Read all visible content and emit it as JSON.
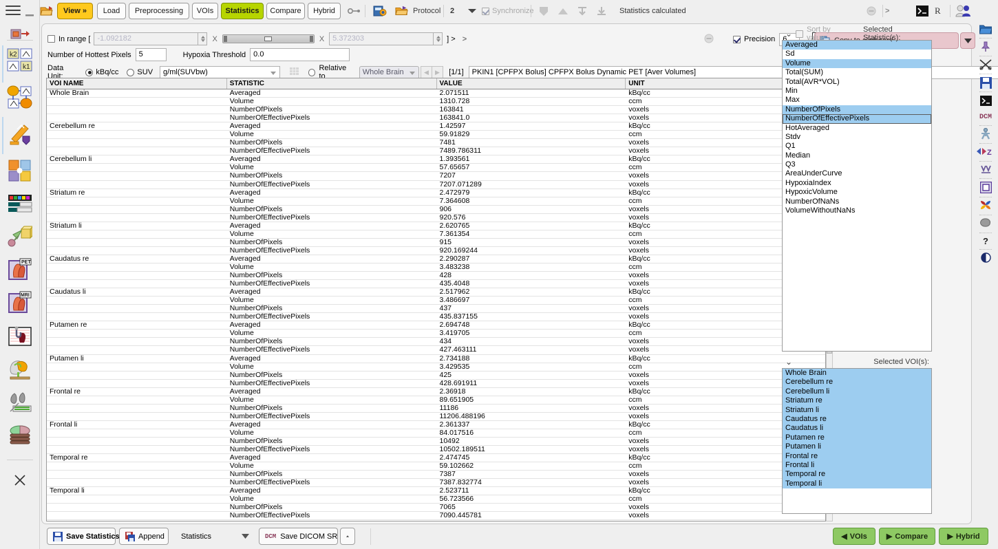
{
  "app": {
    "status_text": "Statistics calculated"
  },
  "toolbar": {
    "menu_icon": "hamburger-icon",
    "buttons": [
      {
        "label": "View »",
        "style": "yellow"
      },
      {
        "label": "Load",
        "style": "plain"
      },
      {
        "label": "Preprocessing",
        "style": "plain"
      },
      {
        "label": "VOIs",
        "style": "plain"
      },
      {
        "label": "Statistics",
        "style": "green"
      },
      {
        "label": "Compare",
        "style": "plain"
      },
      {
        "label": "Hybrid",
        "style": "plain"
      }
    ],
    "protocol_label": "Protocol",
    "series_number": "2",
    "synchronize_label": "Synchronize",
    "r_label": "R"
  },
  "controls": {
    "in_range_label": "In range [",
    "in_range_checked": false,
    "range_min": "-1.092182",
    "range_max": "5.372303",
    "range_close": "] >",
    "multiply_symbol": "X",
    "hottest_pixels_label": "Number of Hottest Pixels",
    "hottest_pixels_value": "5",
    "hypoxia_label": "Hypoxia Threshold",
    "hypoxia_value": "0.0",
    "data_unit_label": "Data Unit:",
    "unit_kbq_label": "kBq/cc",
    "unit_suv_label": "SUV",
    "suv_combo_value": "g/ml(SUVbw)",
    "relative_to_label": "Relative to",
    "relative_to_value": "Whole Brain",
    "page_indicator": "[1/1]",
    "series_description": "PKIN1 [CPFPX Bolus] CPFPX Bolus Dynamic PET [Aver Volumes]",
    "precision_label": "Precision",
    "precision_value": "6",
    "precision_checked": true,
    "copy_clipboard_label": "Copy to clipboard"
  },
  "table": {
    "headers": [
      "VOI NAME",
      "STATISTIC",
      "VALUE",
      "UNIT"
    ],
    "rows": [
      [
        "Whole Brain",
        "Averaged",
        "2.071511",
        "kBq/cc"
      ],
      [
        "",
        "Volume",
        "1310.728",
        "ccm"
      ],
      [
        "",
        "NumberOfPixels",
        "163841",
        "voxels"
      ],
      [
        "",
        "NumberOfEffectivePixels",
        "163841.0",
        "voxels"
      ],
      [
        "Cerebellum re",
        "Averaged",
        "1.42597",
        "kBq/cc"
      ],
      [
        "",
        "Volume",
        "59.91829",
        "ccm"
      ],
      [
        "",
        "NumberOfPixels",
        "7481",
        "voxels"
      ],
      [
        "",
        "NumberOfEffectivePixels",
        "7489.786311",
        "voxels"
      ],
      [
        "Cerebellum li",
        "Averaged",
        "1.393561",
        "kBq/cc"
      ],
      [
        "",
        "Volume",
        "57.65657",
        "ccm"
      ],
      [
        "",
        "NumberOfPixels",
        "7207",
        "voxels"
      ],
      [
        "",
        "NumberOfEffectivePixels",
        "7207.071289",
        "voxels"
      ],
      [
        "Striatum re",
        "Averaged",
        "2.472979",
        "kBq/cc"
      ],
      [
        "",
        "Volume",
        "7.364608",
        "ccm"
      ],
      [
        "",
        "NumberOfPixels",
        "906",
        "voxels"
      ],
      [
        "",
        "NumberOfEffectivePixels",
        "920.576",
        "voxels"
      ],
      [
        "Striatum li",
        "Averaged",
        "2.620765",
        "kBq/cc"
      ],
      [
        "",
        "Volume",
        "7.361354",
        "ccm"
      ],
      [
        "",
        "NumberOfPixels",
        "915",
        "voxels"
      ],
      [
        "",
        "NumberOfEffectivePixels",
        "920.169244",
        "voxels"
      ],
      [
        "Caudatus re",
        "Averaged",
        "2.290287",
        "kBq/cc"
      ],
      [
        "",
        "Volume",
        "3.483238",
        "ccm"
      ],
      [
        "",
        "NumberOfPixels",
        "428",
        "voxels"
      ],
      [
        "",
        "NumberOfEffectivePixels",
        "435.4048",
        "voxels"
      ],
      [
        "Caudatus li",
        "Averaged",
        "2.517962",
        "kBq/cc"
      ],
      [
        "",
        "Volume",
        "3.486697",
        "ccm"
      ],
      [
        "",
        "NumberOfPixels",
        "437",
        "voxels"
      ],
      [
        "",
        "NumberOfEffectivePixels",
        "435.837155",
        "voxels"
      ],
      [
        "Putamen re",
        "Averaged",
        "2.694748",
        "kBq/cc"
      ],
      [
        "",
        "Volume",
        "3.419705",
        "ccm"
      ],
      [
        "",
        "NumberOfPixels",
        "434",
        "voxels"
      ],
      [
        "",
        "NumberOfEffectivePixels",
        "427.463111",
        "voxels"
      ],
      [
        "Putamen li",
        "Averaged",
        "2.734188",
        "kBq/cc"
      ],
      [
        "",
        "Volume",
        "3.429535",
        "ccm"
      ],
      [
        "",
        "NumberOfPixels",
        "425",
        "voxels"
      ],
      [
        "",
        "NumberOfEffectivePixels",
        "428.691911",
        "voxels"
      ],
      [
        "Frontal re",
        "Averaged",
        "2.36918",
        "kBq/cc"
      ],
      [
        "",
        "Volume",
        "89.651905",
        "ccm"
      ],
      [
        "",
        "NumberOfPixels",
        "11186",
        "voxels"
      ],
      [
        "",
        "NumberOfEffectivePixels",
        "11206.488196",
        "voxels"
      ],
      [
        "Frontal li",
        "Averaged",
        "2.361337",
        "kBq/cc"
      ],
      [
        "",
        "Volume",
        "84.017516",
        "ccm"
      ],
      [
        "",
        "NumberOfPixels",
        "10492",
        "voxels"
      ],
      [
        "",
        "NumberOfEffectivePixels",
        "10502.189511",
        "voxels"
      ],
      [
        "Temporal re",
        "Averaged",
        "2.474745",
        "kBq/cc"
      ],
      [
        "",
        "Volume",
        "59.102662",
        "ccm"
      ],
      [
        "",
        "NumberOfPixels",
        "7387",
        "voxels"
      ],
      [
        "",
        "NumberOfEffectivePixels",
        "7387.832774",
        "voxels"
      ],
      [
        "Temporal li",
        "Averaged",
        "2.523711",
        "kBq/cc"
      ],
      [
        "",
        "Volume",
        "56.723566",
        "ccm"
      ],
      [
        "",
        "NumberOfPixels",
        "7065",
        "voxels"
      ],
      [
        "",
        "NumberOfEffectivePixels",
        "7090.445781",
        "voxels"
      ]
    ]
  },
  "statistics_panel": {
    "sort_by_value_label": "Sort by value",
    "sort_by_value_checked": false,
    "title": "Selected Statistic(s):",
    "items": [
      {
        "label": "Averaged",
        "selected": true,
        "focused": false
      },
      {
        "label": "Sd",
        "selected": false,
        "focused": false
      },
      {
        "label": "Volume",
        "selected": true,
        "focused": false
      },
      {
        "label": "Total(SUM)",
        "selected": false,
        "focused": false
      },
      {
        "label": "Total(AVR*VOL)",
        "selected": false,
        "focused": false
      },
      {
        "label": "Min",
        "selected": false,
        "focused": false
      },
      {
        "label": "Max",
        "selected": false,
        "focused": false
      },
      {
        "label": "NumberOfPixels",
        "selected": true,
        "focused": false
      },
      {
        "label": "NumberOfEffectivePixels",
        "selected": true,
        "focused": true
      },
      {
        "label": "HotAveraged",
        "selected": false,
        "focused": false
      },
      {
        "label": "Stdv",
        "selected": false,
        "focused": false
      },
      {
        "label": "Q1",
        "selected": false,
        "focused": false
      },
      {
        "label": "Median",
        "selected": false,
        "focused": false
      },
      {
        "label": "Q3",
        "selected": false,
        "focused": false
      },
      {
        "label": "AreaUnderCurve",
        "selected": false,
        "focused": false
      },
      {
        "label": "HypoxiaIndex",
        "selected": false,
        "focused": false
      },
      {
        "label": "HypoxicVolume",
        "selected": false,
        "focused": false
      },
      {
        "label": "NumberOfNaNs",
        "selected": false,
        "focused": false
      },
      {
        "label": "VolumeWithoutNaNs",
        "selected": false,
        "focused": false
      }
    ]
  },
  "vois_panel": {
    "title": "Selected VOI(s):",
    "items": [
      {
        "label": "Whole Brain",
        "selected": true
      },
      {
        "label": "Cerebellum re",
        "selected": true
      },
      {
        "label": "Cerebellum li",
        "selected": true
      },
      {
        "label": "Striatum re",
        "selected": true
      },
      {
        "label": "Striatum li",
        "selected": true
      },
      {
        "label": "Caudatus re",
        "selected": true
      },
      {
        "label": "Caudatus li",
        "selected": true
      },
      {
        "label": "Putamen re",
        "selected": true
      },
      {
        "label": "Putamen li",
        "selected": true
      },
      {
        "label": "Frontal re",
        "selected": true
      },
      {
        "label": "Frontal li",
        "selected": true
      },
      {
        "label": "Temporal re",
        "selected": true
      },
      {
        "label": "Temporal li",
        "selected": true
      }
    ]
  },
  "bottombar": {
    "save_statistics_label": "Save Statistics",
    "append_label": "Append",
    "statistics_combo_label": "Statistics",
    "save_dicom_label": "Save DICOM SR",
    "dcm_tag": "DCM",
    "vois_label": "VOIs",
    "compare_label": "Compare",
    "hybrid_label": "Hybrid"
  },
  "right_rail": {
    "icons": [
      "open-folder-icon",
      "pin-icon",
      "scissors-icon",
      "save-disk-icon",
      "terminal-icon",
      "dicom-icon",
      "person-icon",
      "flip-z-icon",
      "fusion-icon",
      "frame-icon",
      "colorwheel-icon",
      "brain-icon",
      "help-icon",
      "contrast-icon"
    ]
  },
  "left_rail": {
    "icons": [
      "hamburger-icon",
      "data-transfer-icon",
      "kinetic-modeling-icon",
      "compartment-model-icon",
      "fusion-tool-icon",
      "puzzle-fusion-icon",
      "color-table-icon",
      "3d-render-icon",
      "pet-cardiac-icon",
      "mri-cardiac-icon",
      "cardiac-flow-icon",
      "brain-render-icon",
      "lung-icon",
      "body-stack-icon",
      "close-icon"
    ]
  },
  "colors": {
    "accent_yellow": "#ffc91e",
    "accent_green": "#b7d500",
    "selection_blue": "#9dcdf0",
    "button_green": "#8ec963",
    "pink_button": "#e9c7cd"
  }
}
